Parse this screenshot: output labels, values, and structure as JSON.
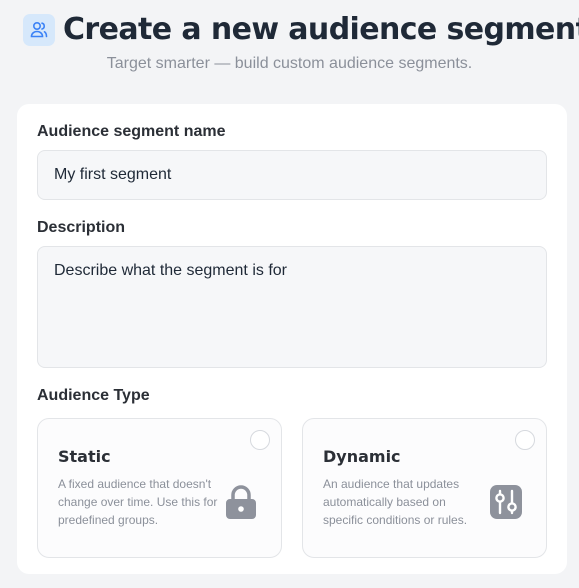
{
  "header": {
    "title": "Create a new audience segment",
    "subtitle": "Target smarter — build custom audience segments.",
    "icon": "users-icon",
    "icon_color": "#3b82f6",
    "icon_bg": "#d6e8fb"
  },
  "form": {
    "name_label": "Audience segment name",
    "name_placeholder": "My first segment",
    "description_label": "Description",
    "description_placeholder": "Describe what the segment is for",
    "type_label": "Audience Type",
    "types": [
      {
        "title": "Static",
        "description": "A fixed audience that doesn't change over time. Use this for predefined groups.",
        "icon": "lock-icon",
        "selected": false
      },
      {
        "title": "Dynamic",
        "description": "An audience that updates automatically based on specific conditions or rules.",
        "icon": "sliders-icon",
        "selected": false
      }
    ]
  },
  "colors": {
    "background": "#f3f4f6",
    "card": "#ffffff",
    "icon_gray": "#8e929c"
  }
}
